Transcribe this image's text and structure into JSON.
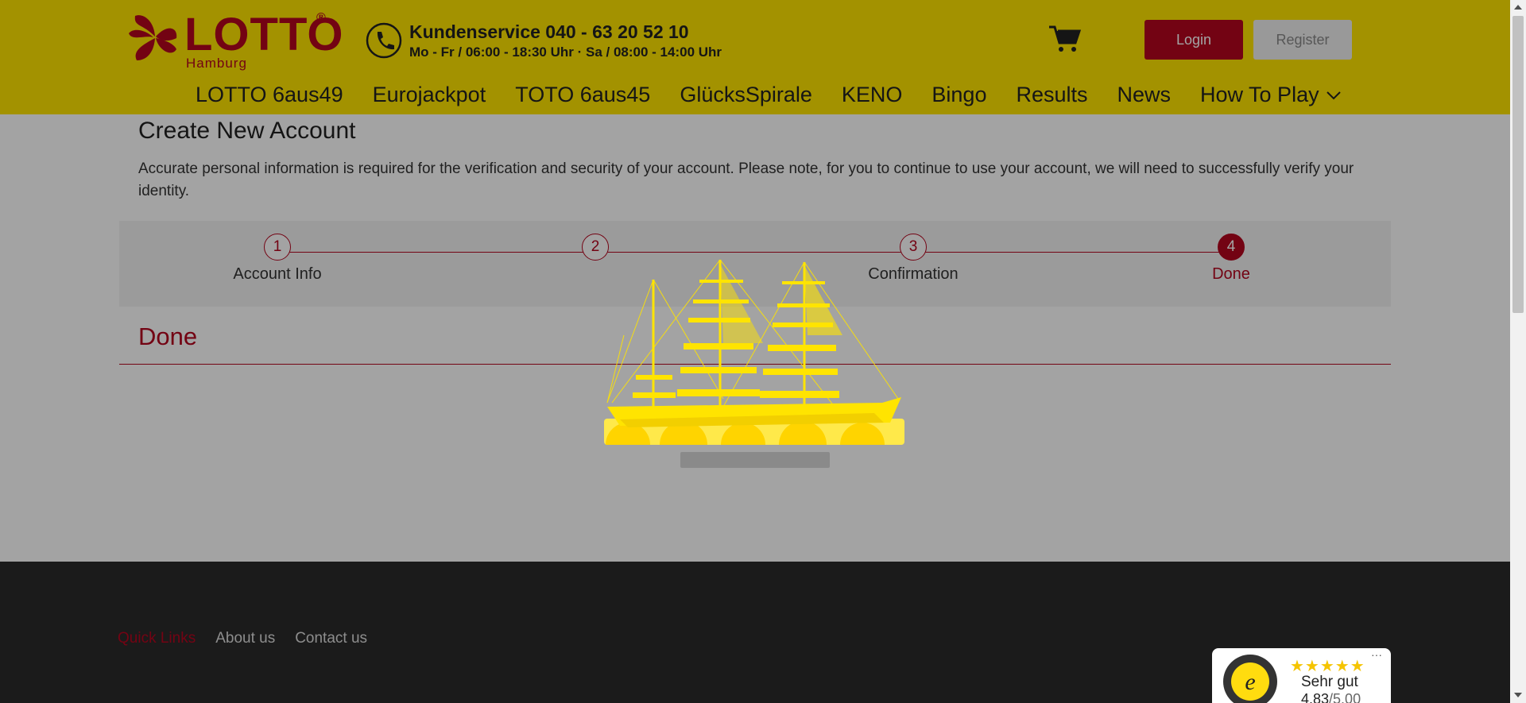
{
  "colors": {
    "brand_yellow": "#ffe400",
    "brand_red": "#b5061f",
    "footer": "#2b2b2b"
  },
  "header": {
    "logo_text": "LOTTO",
    "logo_reg": "®",
    "logo_sub": "Hamburg",
    "service_title": "Kundenservice 040 - 63 20 52 10",
    "service_hours": "Mo - Fr / 06:00 - 18:30 Uhr · Sa / 08:00 - 14:00 Uhr",
    "login_label": "Login",
    "register_label": "Register",
    "icons": {
      "phone": "phone-icon",
      "cart": "cart-icon",
      "dropdown": "chevron-down-icon"
    }
  },
  "nav": {
    "items": [
      {
        "label": "LOTTO 6aus49"
      },
      {
        "label": "Eurojackpot"
      },
      {
        "label": "TOTO 6aus45"
      },
      {
        "label": "GlücksSpirale"
      },
      {
        "label": "KENO"
      },
      {
        "label": "Bingo"
      },
      {
        "label": "Results"
      },
      {
        "label": "News"
      },
      {
        "label": "How To Play"
      }
    ]
  },
  "main": {
    "title": "Create New Account",
    "intro": "Accurate personal information is required for the verification and security of your account. Please note, for you to continue to use your account, we will need to successfully verify your identity.",
    "steps": [
      {
        "number": "1",
        "label": "Account Info",
        "active": false
      },
      {
        "number": "2",
        "label": "",
        "active": false
      },
      {
        "number": "3",
        "label": "Confirmation",
        "active": false
      },
      {
        "number": "4",
        "label": "Done",
        "active": true
      }
    ],
    "section_title": "Done"
  },
  "footer": {
    "links": [
      {
        "label": "Quick Links"
      },
      {
        "label": "About us"
      },
      {
        "label": "Contact us"
      }
    ]
  },
  "trusted": {
    "stars": "★★★★★",
    "rating_label": "Sehr gut",
    "score": "4.83",
    "score_max": "/5.00",
    "more": "···"
  }
}
